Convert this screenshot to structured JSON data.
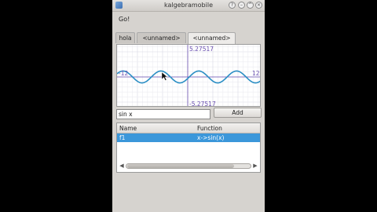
{
  "window": {
    "title": "kalgebramobile"
  },
  "go_label": "Go!",
  "tabs": [
    {
      "label": "hola"
    },
    {
      "label": "<unnamed>"
    },
    {
      "label": "<unnamed>"
    }
  ],
  "plot": {
    "y_max_label": "5.27517",
    "y_min_label": "-5.27517",
    "x_min_label": "-12",
    "x_max_label": "12",
    "curve_color": "#2a8ec4",
    "axis_color": "#6a4fb0"
  },
  "input": {
    "value": "sin x"
  },
  "add_label": "Add",
  "table": {
    "headers": [
      "Name",
      "Function"
    ],
    "rows": [
      {
        "name": "f1",
        "function": "x->sin(x)"
      }
    ]
  }
}
